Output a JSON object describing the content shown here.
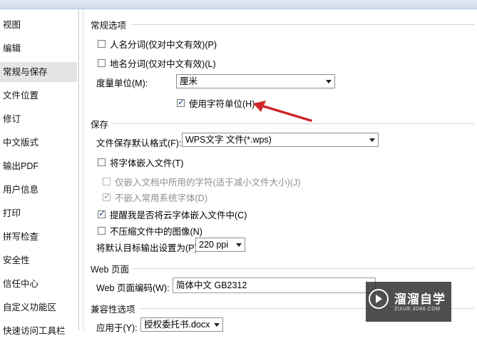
{
  "sidebar": {
    "items": [
      {
        "label": "视图"
      },
      {
        "label": "编辑"
      },
      {
        "label": "常规与保存",
        "selected": true
      },
      {
        "label": "文件位置"
      },
      {
        "label": "修订"
      },
      {
        "label": "中文版式"
      },
      {
        "label": "输出PDF"
      },
      {
        "label": "用户信息"
      },
      {
        "label": "打印"
      },
      {
        "label": "拼写检查"
      },
      {
        "label": "安全性"
      },
      {
        "label": "信任中心"
      },
      {
        "label": "自定义功能区"
      },
      {
        "label": "快速访问工具栏"
      }
    ]
  },
  "general": {
    "title": "常规选项",
    "person_name_seg": {
      "label": "人名分词(仅对中文有效)(P)",
      "checked": false
    },
    "place_name_seg": {
      "label": "地名分词(仅对中文有效)(L)",
      "checked": false
    },
    "unit_label": "度量单位(M):",
    "unit_value": "厘米",
    "char_unit": {
      "label": "使用字符单位(H)",
      "checked": true
    }
  },
  "save": {
    "title": "保存",
    "default_format_label": "文件保存默认格式(F):",
    "default_format_value": "WPS文字 文件(*.wps)",
    "embed_fonts": {
      "label": "将字体嵌入文件(T)",
      "checked": false
    },
    "embed_used_only": {
      "label": "仅嵌入文档中所用的字符(适于减小文件大小)(J)",
      "checked": false,
      "disabled": true
    },
    "no_common_fonts": {
      "label": "不嵌入常用系统字体(D)",
      "checked": true,
      "disabled": true
    },
    "cloud_font_reminder": {
      "label": "提醒我是否将云字体嵌入文件中(C)",
      "checked": true
    },
    "no_compress_images": {
      "label": "不压缩文件中的图像(N)",
      "checked": false
    },
    "target_output_label": "将默认目标输出设置为(P):",
    "target_output_value": "220 ppi"
  },
  "web": {
    "title": "Web 页面",
    "encoding_label": "Web 页面编码(W):",
    "encoding_value": "简体中文 GB2312"
  },
  "compat": {
    "title": "兼容性选项",
    "apply_to_label": "应用于(Y):",
    "apply_to_value": "授权委托书.docx"
  },
  "watermark": {
    "brand": "溜溜自学",
    "url": "ZIXUE.3D66.COM"
  },
  "colors": {
    "arrow": "#d0282a",
    "selected_bg": "#e5e5e5",
    "check": "#1a3c8c"
  }
}
